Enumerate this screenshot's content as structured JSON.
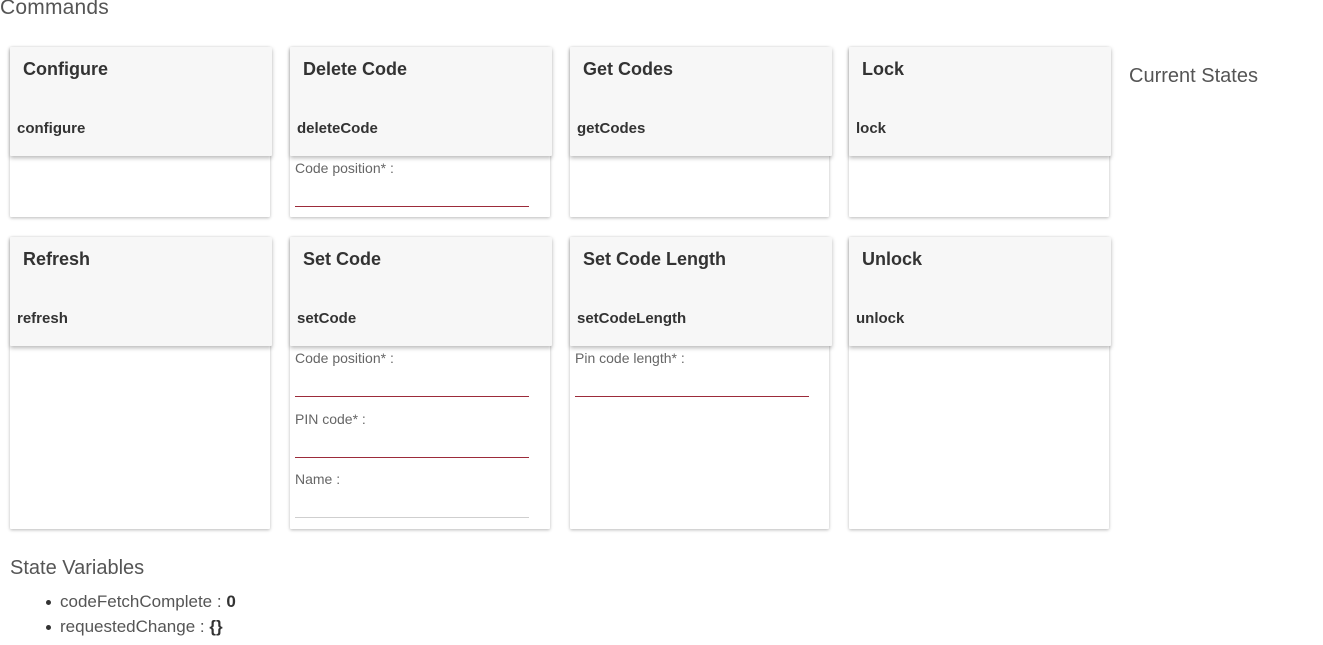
{
  "page": {
    "commands_title": "Commands",
    "current_states_title": "Current States",
    "state_variables_title": "State Variables"
  },
  "commands": {
    "configure": {
      "title": "Configure",
      "command": "configure"
    },
    "delete_code": {
      "title": "Delete Code",
      "command": "deleteCode",
      "fields": {
        "code_position": {
          "label": "Code position* :",
          "value": ""
        }
      }
    },
    "get_codes": {
      "title": "Get Codes",
      "command": "getCodes"
    },
    "lock": {
      "title": "Lock",
      "command": "lock"
    },
    "refresh": {
      "title": "Refresh",
      "command": "refresh"
    },
    "set_code": {
      "title": "Set Code",
      "command": "setCode",
      "fields": {
        "code_position": {
          "label": "Code position* :",
          "value": ""
        },
        "pin_code": {
          "label": "PIN code* :",
          "value": ""
        },
        "name": {
          "label": "Name :",
          "value": ""
        }
      }
    },
    "set_code_length": {
      "title": "Set Code Length",
      "command": "setCodeLength",
      "fields": {
        "pin_code_length": {
          "label": "Pin code length* :",
          "value": ""
        }
      }
    },
    "unlock": {
      "title": "Unlock",
      "command": "unlock"
    }
  },
  "state_variables": [
    {
      "name": "codeFetchComplete",
      "separator": " : ",
      "value": "0"
    },
    {
      "name": "requestedChange",
      "separator": " : ",
      "value": "{}"
    }
  ],
  "colors": {
    "required_underline": "#9c2b3a",
    "header_bg": "#f7f7f7"
  }
}
